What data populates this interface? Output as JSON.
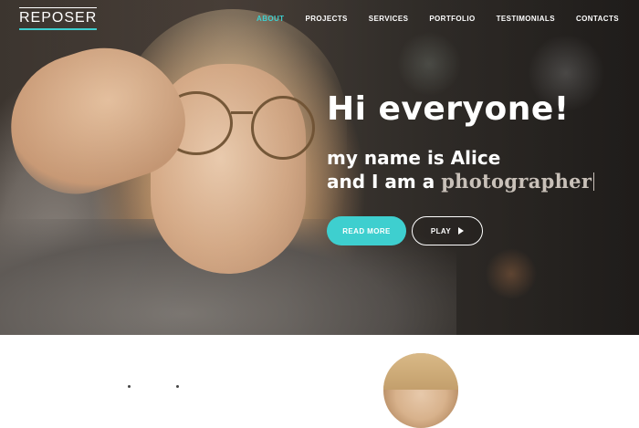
{
  "brand": {
    "logo": "REPOSER",
    "accent_color": "#3ecfcf"
  },
  "nav": {
    "items": [
      {
        "label": "ABOUT",
        "active": true
      },
      {
        "label": "PROJECTS",
        "active": false
      },
      {
        "label": "SERVICES",
        "active": false
      },
      {
        "label": "PORTFOLIO",
        "active": false
      },
      {
        "label": "TESTIMONIALS",
        "active": false
      },
      {
        "label": "CONTACTS",
        "active": false
      }
    ]
  },
  "hero": {
    "headline": "Hi everyone!",
    "line1": "my name is Alice",
    "line2_prefix": "and I am a ",
    "typed_word": "photographer",
    "read_more_label": "READ MORE",
    "play_label": "PLAY",
    "play_icon": "play-icon"
  }
}
